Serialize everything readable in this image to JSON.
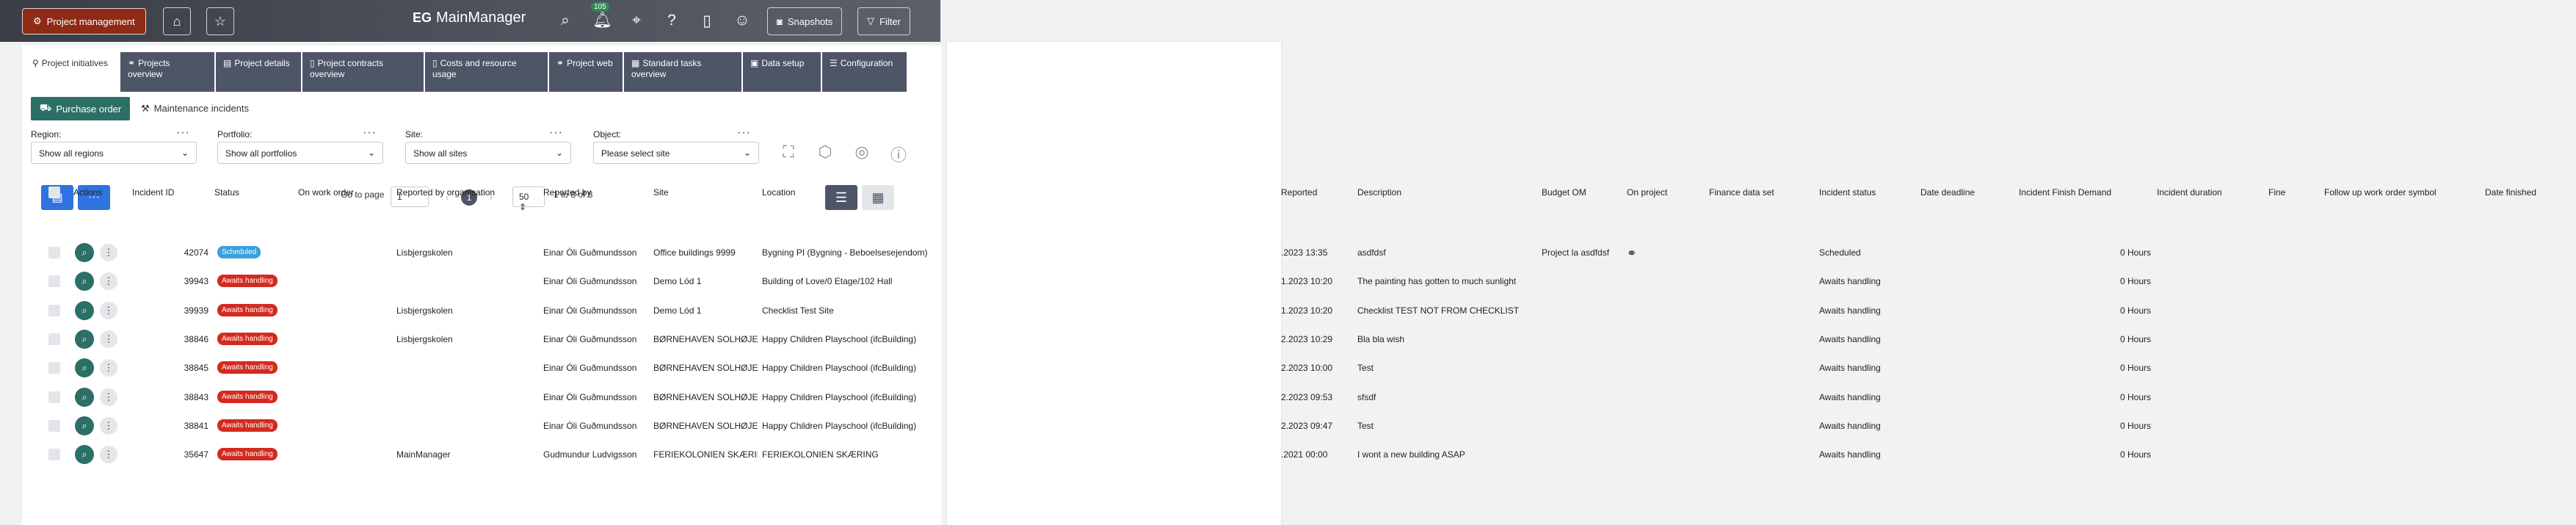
{
  "topbar": {
    "project_management": "Project management",
    "brand_eg": "EG",
    "brand_name": "MainManager",
    "notification_count": "105",
    "snapshots": "Snapshots",
    "filter": "Filter"
  },
  "tabs": [
    {
      "label": "Project initiatives",
      "icon": "pin-icon"
    },
    {
      "label": "Projects overview",
      "icon": "network-icon"
    },
    {
      "label": "Project details",
      "icon": "details-icon"
    },
    {
      "label": "Project contracts overview",
      "icon": "document-icon"
    },
    {
      "label": "Costs and resource usage",
      "icon": "document-icon"
    },
    {
      "label": "Project web",
      "icon": "network-icon"
    },
    {
      "label": "Standard tasks overview",
      "icon": "calendar-icon"
    },
    {
      "label": "Data setup",
      "icon": "data-icon"
    },
    {
      "label": "Configuration",
      "icon": "sliders-icon"
    }
  ],
  "actions": {
    "purchase_order": "Purchase order",
    "maintenance_incidents": "Maintenance incidents"
  },
  "filters": {
    "region_label": "Region:",
    "region_value": "Show all regions",
    "portfolio_label": "Portfolio:",
    "portfolio_value": "Show all portfolios",
    "site_label": "Site:",
    "site_value": "Show all sites",
    "object_label": "Object:",
    "object_value": "Please select site"
  },
  "pager": {
    "go_to_page": "Go to page",
    "page_input": "1",
    "current_page": "1",
    "page_size": "50",
    "range_text": "1 to 8 of 8"
  },
  "table": {
    "headers": {
      "actions": "Actions",
      "incident_id": "Incident ID",
      "status": "Status",
      "on_work_order": "On work order",
      "reported_by_org": "Reported by organisation",
      "reported_by": "Reported by",
      "site": "Site",
      "location": "Location",
      "reported": "Reported",
      "description": "Description",
      "budget_om": "Budget OM",
      "on_project": "On project",
      "finance_data_set": "Finance data set",
      "incident_status": "Incident status",
      "date_deadline": "Date deadline",
      "finish_demand": "Incident Finish Demand",
      "duration": "Incident duration",
      "fine": "Fine",
      "follow_up_symbol": "Follow up work order symbol",
      "date_finished": "Date finished"
    },
    "rows": [
      {
        "id": "42074",
        "status": "Scheduled",
        "org": "Lisbjergskolen",
        "reported_by": "Einar Óli Guðmundsson",
        "site": "Office buildings 9999",
        "location": "Bygning PI (Bygning - Beboelsesejendom)",
        "reported": ".2023 13:35",
        "description": "asdfdsf",
        "budget": "Project la asdfdsf",
        "incident_status": "Scheduled",
        "finish_demand": "0 Hours"
      },
      {
        "id": "39943",
        "status": "Awaits handling",
        "org": "",
        "reported_by": "Einar Óli Guðmundsson",
        "site": "Demo Lód 1",
        "location": "Building of Love/0 Etage/102 Hall",
        "reported": "1.2023 10:20",
        "description": "The painting has gotten to much sunlight",
        "budget": "",
        "incident_status": "Awaits handling",
        "finish_demand": "0 Hours"
      },
      {
        "id": "39939",
        "status": "Awaits handling",
        "org": "Lisbjergskolen",
        "reported_by": "Einar Óli Guðmundsson",
        "site": "Demo Lód 1",
        "location": "Checklist Test Site",
        "reported": "1.2023 10:20",
        "description": "Checklist TEST NOT FROM CHECKLIST",
        "budget": "",
        "incident_status": "Awaits handling",
        "finish_demand": "0 Hours"
      },
      {
        "id": "38846",
        "status": "Awaits handling",
        "org": "Lisbjergskolen",
        "reported_by": "Einar Óli Guðmundsson",
        "site": "BØRNEHAVEN SOLHØJEN",
        "location": "Happy Children Playschool (ifcBuilding)",
        "reported": "2.2023 10:29",
        "description": "Bla bla wish",
        "budget": "",
        "incident_status": "Awaits handling",
        "finish_demand": "0 Hours"
      },
      {
        "id": "38845",
        "status": "Awaits handling",
        "org": "",
        "reported_by": "Einar Óli Guðmundsson",
        "site": "BØRNEHAVEN SOLHØJEN",
        "location": "Happy Children Playschool (ifcBuilding)",
        "reported": "2.2023 10:00",
        "description": "Test",
        "budget": "",
        "incident_status": "Awaits handling",
        "finish_demand": "0 Hours"
      },
      {
        "id": "38843",
        "status": "Awaits handling",
        "org": "",
        "reported_by": "Einar Óli Guðmundsson",
        "site": "BØRNEHAVEN SOLHØJEN",
        "location": "Happy Children Playschool (ifcBuilding)",
        "reported": "2.2023 09:53",
        "description": "sfsdf",
        "budget": "",
        "incident_status": "Awaits handling",
        "finish_demand": "0 Hours"
      },
      {
        "id": "38841",
        "status": "Awaits handling",
        "org": "",
        "reported_by": "Einar Óli Guðmundsson",
        "site": "BØRNEHAVEN SOLHØJEN",
        "location": "Happy Children Playschool (ifcBuilding)",
        "reported": "2.2023 09:47",
        "description": "Test",
        "budget": "",
        "incident_status": "Awaits handling",
        "finish_demand": "0 Hours"
      },
      {
        "id": "35647",
        "status": "Awaits handling",
        "org": "MainManager",
        "reported_by": "Gudmundur Ludvigsson",
        "site": "FERIEKOLONIEN SKÆRING",
        "location": "FERIEKOLONIEN SKÆRING",
        "reported": ".2021 00:00",
        "description": "I wont a new building ASAP",
        "budget": "",
        "incident_status": "Awaits handling",
        "finish_demand": "0 Hours"
      }
    ]
  },
  "colors": {
    "accent_green": "#2c6f66",
    "tab_dark": "#4d5566",
    "status_scheduled": "#3aa0db",
    "status_awaits": "#d42a1e",
    "brand_red": "#8f2a14"
  }
}
